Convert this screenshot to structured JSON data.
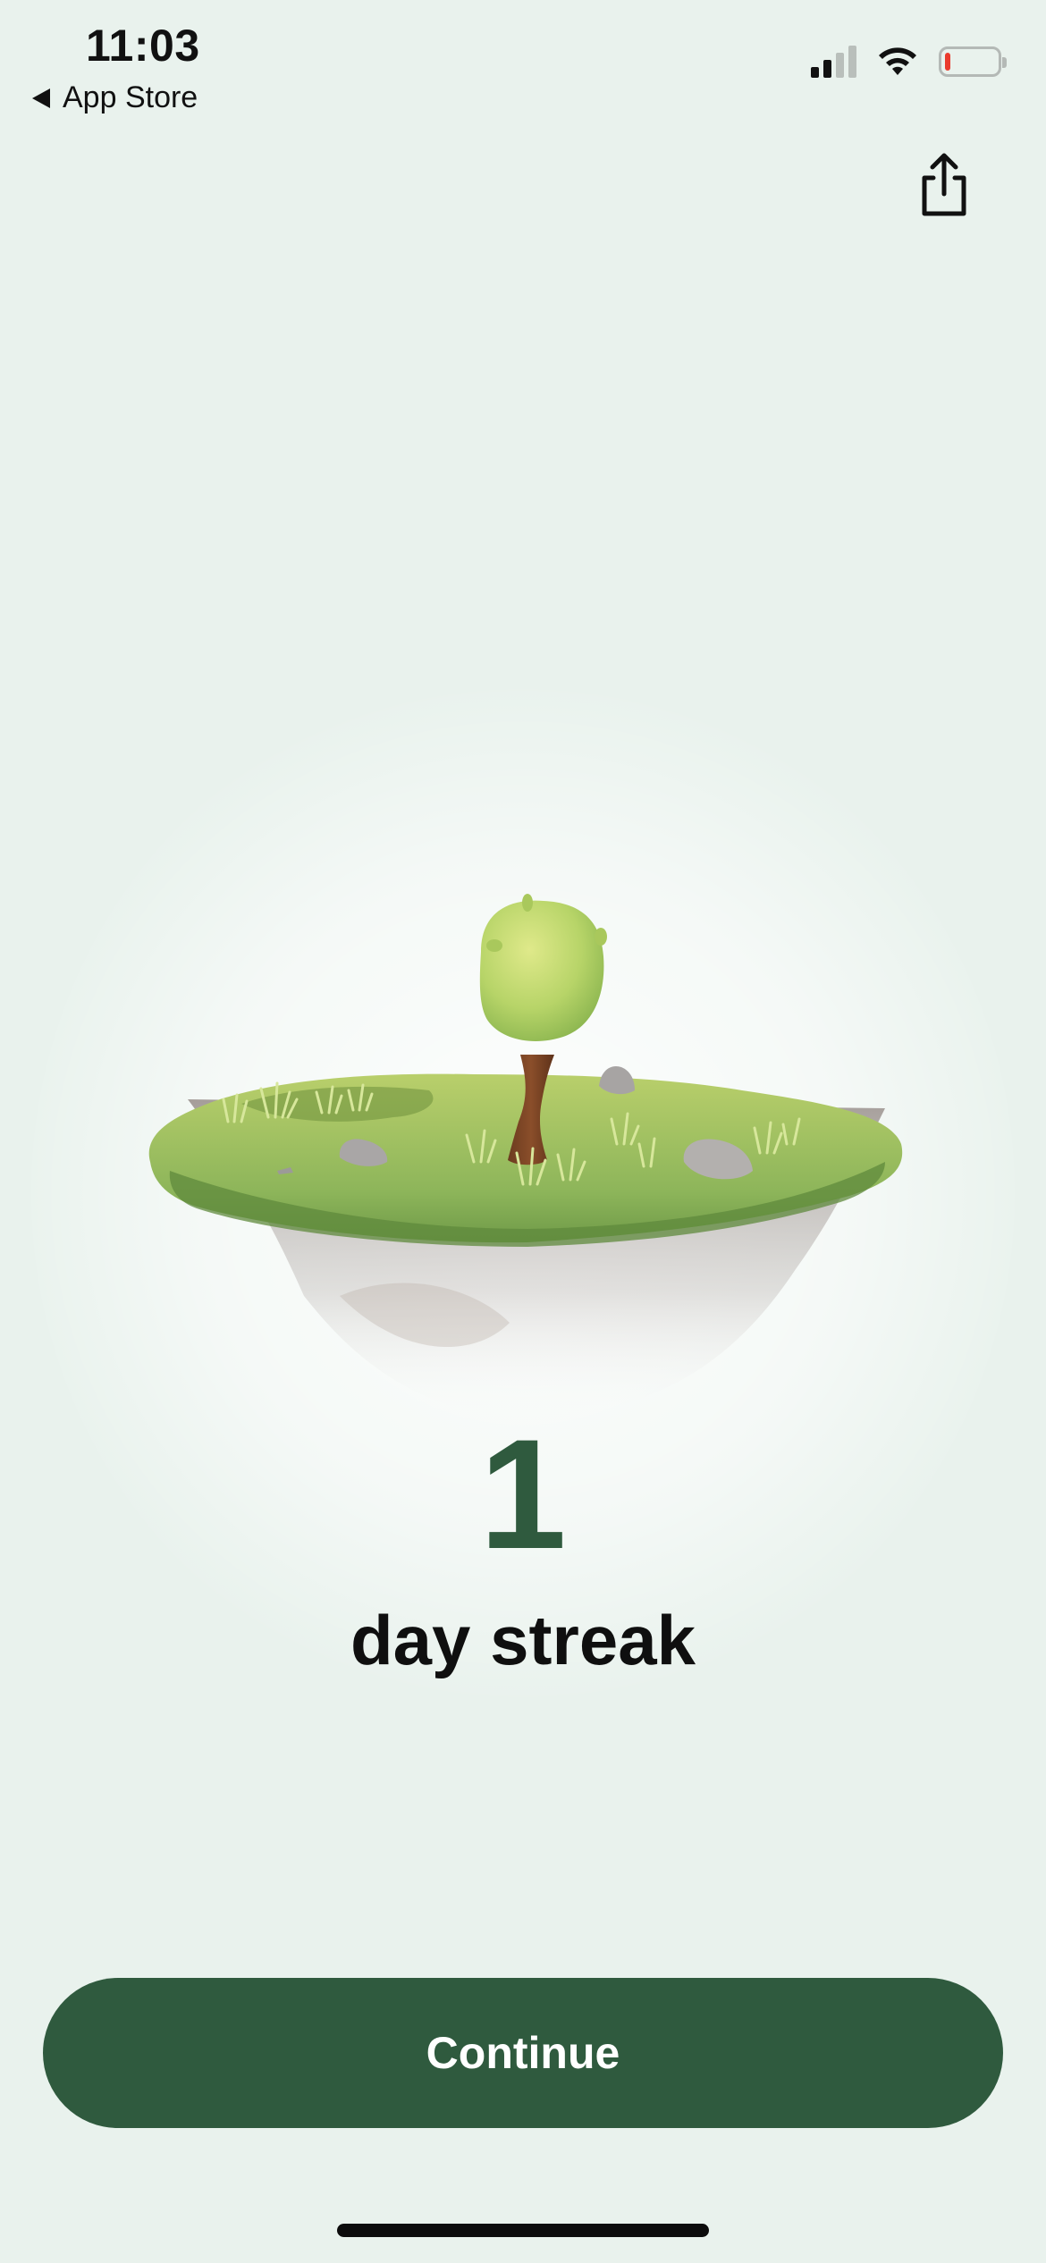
{
  "status_bar": {
    "time": "11:03",
    "back_label": "App Store",
    "signal_bars_filled": 2,
    "signal_bars_total": 4,
    "battery_level_pct": 10,
    "battery_color": "#ea3b2d"
  },
  "header": {
    "share_icon": "share-icon"
  },
  "streak": {
    "count": "1",
    "label": "day streak"
  },
  "actions": {
    "continue_label": "Continue"
  },
  "colors": {
    "background": "#e9f2ed",
    "accent_green": "#2f5a3e",
    "text": "#111111"
  }
}
